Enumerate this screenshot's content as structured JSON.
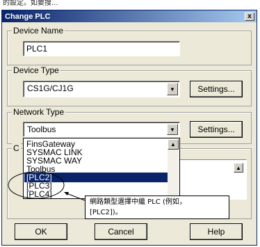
{
  "page_text": "的設定。如要搜...",
  "window": {
    "title": "Change PLC",
    "close_glyph": "x"
  },
  "device_name": {
    "label": "Device Name",
    "value": "PLC1"
  },
  "device_type": {
    "label": "Device Type",
    "value": "CS1G/CJ1G",
    "settings_label": "Settings..."
  },
  "network_type": {
    "label": "Network Type",
    "value": "Toolbus",
    "settings_label": "Settings...",
    "options": [
      "FinsGateway",
      "SYSMAC LINK",
      "SYSMAC WAY",
      "Toolbus",
      "[PLC2]",
      "[PLC3]",
      "[PLC4]"
    ],
    "selected_index": 4
  },
  "hidden_group_label": "C",
  "callout": {
    "line1": "網路類型選擇中繼 PLC (例如，",
    "line2": "[PLC2])。"
  },
  "buttons": {
    "ok": "OK",
    "cancel": "Cancel",
    "help": "Help"
  },
  "icons": {
    "dropdown_arrow": "▼",
    "scroll_up": "▲"
  }
}
